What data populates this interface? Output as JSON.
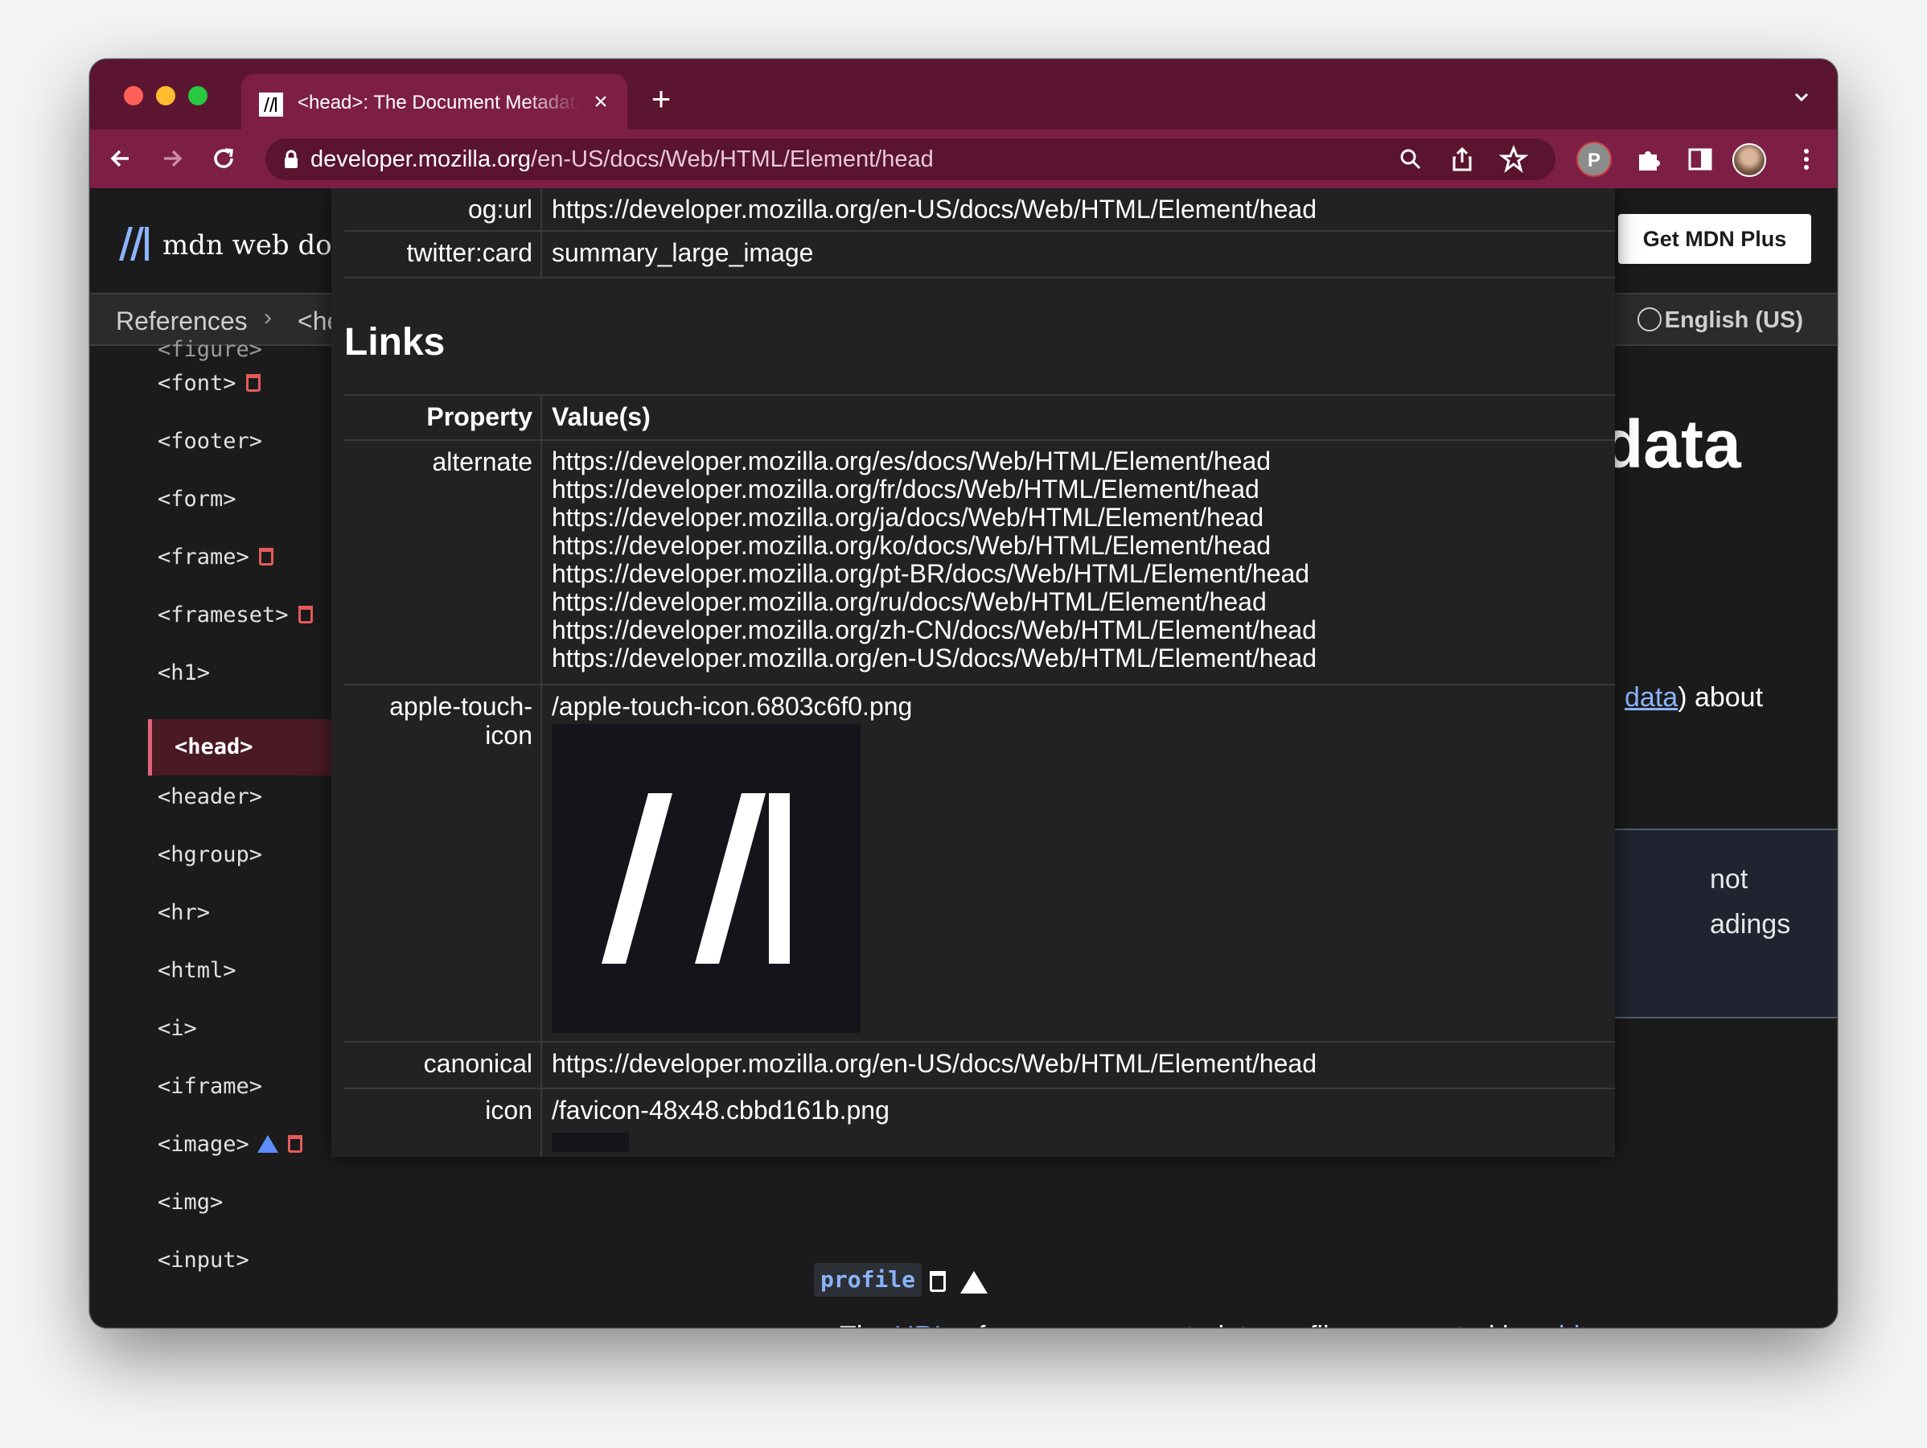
{
  "browser": {
    "tab_title": "<head>: The Document Metadata (Header) element - HTML: HyperText Markup Language | MDN",
    "new_tab": "+",
    "close": "×",
    "url_host": "developer.mozilla.org",
    "url_path": "/en-US/docs/Web/HTML/Element/head",
    "profile_letter": "P"
  },
  "mdn": {
    "logo_text": "mdn web docs",
    "get_plus": "Get MDN Plus",
    "breadcrumb_1": "References",
    "breadcrumb_sep": "›",
    "breadcrumb_2": "<head>",
    "language": "English (US)"
  },
  "sidebar": {
    "clipped": "<figure>",
    "items": [
      {
        "label": "<font>",
        "trash": true,
        "warn": false
      },
      {
        "label": "<footer>",
        "trash": false,
        "warn": false
      },
      {
        "label": "<form>",
        "trash": false,
        "warn": false
      },
      {
        "label": "<frame>",
        "trash": true,
        "warn": false
      },
      {
        "label": "<frameset>",
        "trash": true,
        "warn": false
      },
      {
        "label": "<h1>",
        "trash": false,
        "warn": false
      },
      {
        "label": "<header>",
        "trash": false,
        "warn": false
      },
      {
        "label": "<hgroup>",
        "trash": false,
        "warn": false
      },
      {
        "label": "<hr>",
        "trash": false,
        "warn": false
      },
      {
        "label": "<html>",
        "trash": false,
        "warn": false
      },
      {
        "label": "<i>",
        "trash": false,
        "warn": false
      },
      {
        "label": "<iframe>",
        "trash": false,
        "warn": false
      },
      {
        "label": "<image>",
        "trash": true,
        "warn": true
      },
      {
        "label": "<img>",
        "trash": false,
        "warn": false
      },
      {
        "label": "<input>",
        "trash": false,
        "warn": false
      }
    ],
    "active": "<head>"
  },
  "main": {
    "heading_partial": "data",
    "text_link": "data",
    "text_after": ") about",
    "note_line_1": "not",
    "note_line_2": "adings",
    "attr_name": "profile",
    "desc_before": "The ",
    "desc_link1": "URI",
    "desc_mid": "s of one or more metadata profiles, separated by ",
    "desc_link2": "white space",
    "desc_end": "."
  },
  "overlay": {
    "meta_rows": [
      {
        "key": "og:url",
        "value": "https://developer.mozilla.org/en-US/docs/Web/HTML/Element/head"
      },
      {
        "key": "twitter:card",
        "value": "summary_large_image"
      }
    ],
    "links_title": "Links",
    "header_key": "Property",
    "header_value": "Value(s)",
    "alternate_key": "alternate",
    "alternate_values": [
      "https://developer.mozilla.org/es/docs/Web/HTML/Element/head",
      "https://developer.mozilla.org/fr/docs/Web/HTML/Element/head",
      "https://developer.mozilla.org/ja/docs/Web/HTML/Element/head",
      "https://developer.mozilla.org/ko/docs/Web/HTML/Element/head",
      "https://developer.mozilla.org/pt-BR/docs/Web/HTML/Element/head",
      "https://developer.mozilla.org/ru/docs/Web/HTML/Element/head",
      "https://developer.mozilla.org/zh-CN/docs/Web/HTML/Element/head",
      "https://developer.mozilla.org/en-US/docs/Web/HTML/Element/head"
    ],
    "touch_key_1": "apple-touch-",
    "touch_key_2": "icon",
    "touch_value": "/apple-touch-icon.6803c6f0.png",
    "canonical_key": "canonical",
    "canonical_value": "https://developer.mozilla.org/en-US/docs/Web/HTML/Element/head",
    "icon_key": "icon",
    "icon_value": "/favicon-48x48.cbbd161b.png"
  },
  "colors": {
    "tabstrip": "#5c1530",
    "toolbar": "#7d1f45",
    "link": "#8cb4ff",
    "deprecated": "#e45a5a",
    "active_item": "#4a1a24"
  }
}
